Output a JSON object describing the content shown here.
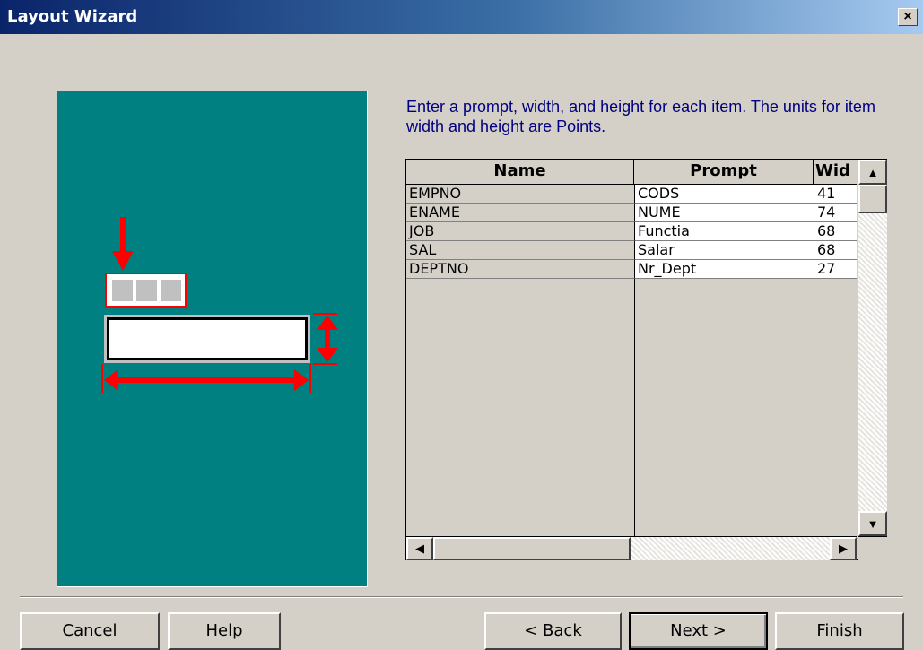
{
  "window": {
    "title": "Layout Wizard",
    "close_glyph": "×"
  },
  "instruction": "Enter a prompt, width, and height for each item. The units for item width and height are Points.",
  "grid": {
    "headers": {
      "name": "Name",
      "prompt": "Prompt",
      "width": "Wid"
    },
    "rows": [
      {
        "name": "EMPNO",
        "prompt": "CODS",
        "width": "41"
      },
      {
        "name": "ENAME",
        "prompt": "NUME",
        "width": "74"
      },
      {
        "name": "JOB",
        "prompt": "Functia",
        "width": "68"
      },
      {
        "name": "SAL",
        "prompt": "Salar",
        "width": "68"
      },
      {
        "name": "DEPTNO",
        "prompt": "Nr_Dept",
        "width": "27"
      }
    ],
    "scroll_up_glyph": "▲",
    "scroll_down_glyph": "▼",
    "scroll_left_glyph": "◀",
    "scroll_right_glyph": "▶"
  },
  "buttons": {
    "cancel": "Cancel",
    "help": "Help",
    "back": "< Back",
    "next": "Next >",
    "finish": "Finish"
  },
  "colors": {
    "illustration_bg": "#008080",
    "arrow_red": "#ff0000",
    "instruction_text": "#000080",
    "title_gradient_start": "#0a246a",
    "title_gradient_end": "#a6caf0"
  },
  "icons": {
    "illustration": "layout-diagram-icon"
  }
}
